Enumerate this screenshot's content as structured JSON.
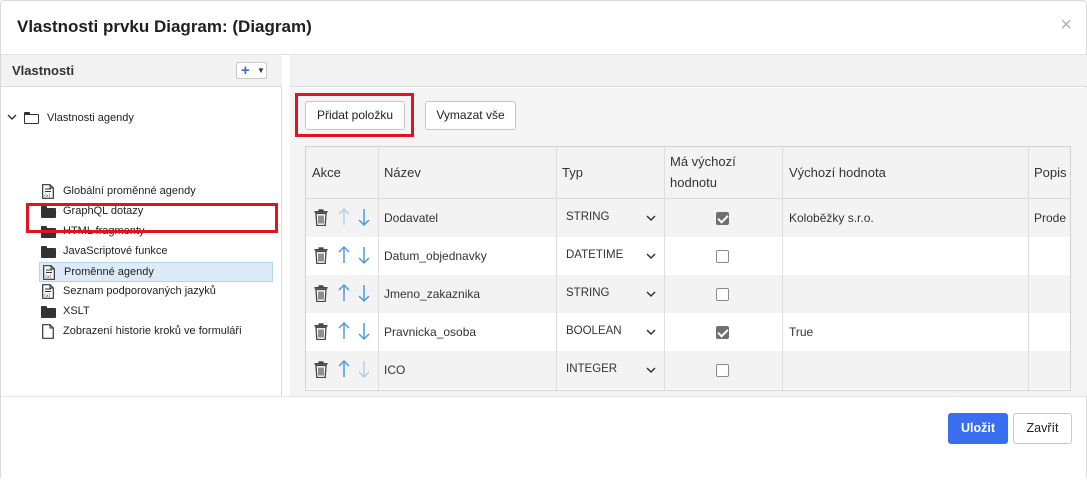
{
  "dialog": {
    "title": "Vlastnosti prvku Diagram: (Diagram)",
    "close_glyph": "×"
  },
  "left": {
    "title": "Vlastnosti",
    "add_glyph": "+",
    "tree": {
      "root": {
        "label": "Vlastnosti agendy",
        "icon": "folder-open-icon",
        "expanded": true
      },
      "items": [
        {
          "label": "Globální proměnné agendy",
          "icon": "variables-doc-icon"
        },
        {
          "label": "GraphQL dotazy",
          "icon": "folder-icon"
        },
        {
          "label": "HTML fragmenty",
          "icon": "folder-icon"
        },
        {
          "label": "JavaScriptové funkce",
          "icon": "folder-icon"
        },
        {
          "label": "Proměnné agendy",
          "icon": "variables-doc-icon",
          "selected": true
        },
        {
          "label": "Seznam podporovaných jazyků",
          "icon": "variables-doc-icon"
        },
        {
          "label": "XSLT",
          "icon": "folder-icon"
        },
        {
          "label": "Zobrazení historie kroků ve formuláři",
          "icon": "document-icon"
        }
      ]
    }
  },
  "right": {
    "add_button": "Přidat položku",
    "clear_button": "Vymazat vše",
    "table": {
      "headers": {
        "actions": "Akce",
        "name": "Název",
        "type": "Typ",
        "has_default_1": "Má výchozí",
        "has_default_2": "hodnotu",
        "default_value": "Výchozí hodnota",
        "description": "Popis"
      },
      "rows": [
        {
          "name": "Dodavatel",
          "type": "STRING",
          "has_default": true,
          "default_value": "Koloběžky s.r.o.",
          "description": "Prode"
        },
        {
          "name": "Datum_objednavky",
          "type": "DATETIME",
          "has_default": false,
          "default_value": "",
          "description": ""
        },
        {
          "name": "Jmeno_zakaznika",
          "type": "STRING",
          "has_default": false,
          "default_value": "",
          "description": ""
        },
        {
          "name": "Pravnicka_osoba",
          "type": "BOOLEAN",
          "has_default": true,
          "default_value": "True",
          "description": ""
        },
        {
          "name": "ICO",
          "type": "INTEGER",
          "has_default": false,
          "default_value": "",
          "description": ""
        }
      ]
    }
  },
  "footer": {
    "save": "Uložit",
    "close": "Zavřít"
  },
  "colors": {
    "primary": "#3a6ef0",
    "highlight": "#e0141e",
    "arrow_active": "#4a9be0",
    "arrow_disabled": "#b5cfe6"
  }
}
